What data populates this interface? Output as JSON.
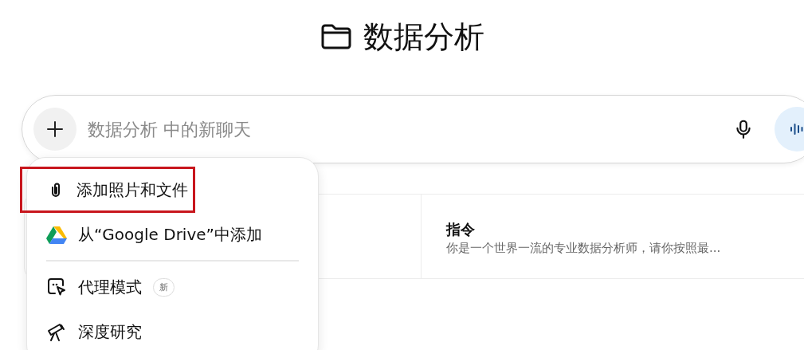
{
  "project": {
    "title": "数据分析"
  },
  "composer": {
    "placeholder": "数据分析 中的新聊天"
  },
  "cards": [
    {
      "title": "指令",
      "description": "你是一个世界一流的专业数据分析师，请你按照最..."
    }
  ],
  "menu": {
    "items": [
      {
        "kind": "attach",
        "label": "添加照片和文件",
        "highlighted": true
      },
      {
        "kind": "drive",
        "label": "从“Google Drive”中添加",
        "highlighted": false
      },
      {
        "kind": "divider"
      },
      {
        "kind": "agent",
        "label": "代理模式",
        "badge": "新",
        "highlighted": false
      },
      {
        "kind": "research",
        "label": "深度研究",
        "highlighted": false
      }
    ]
  }
}
